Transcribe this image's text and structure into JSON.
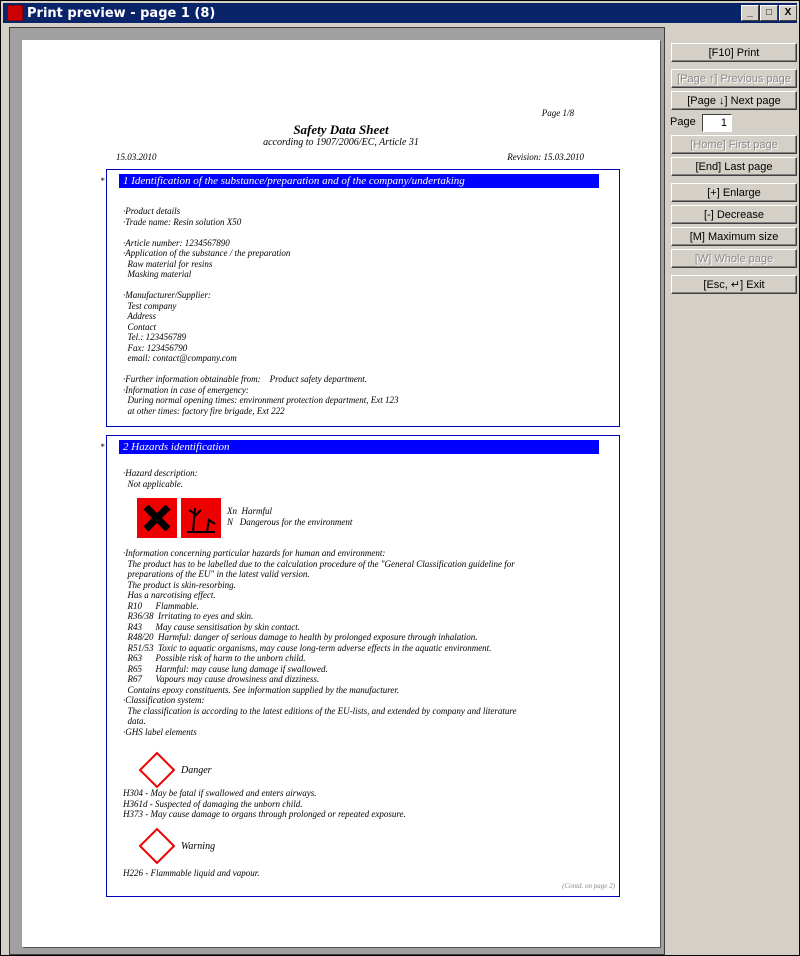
{
  "window": {
    "title": "Print preview - page 1 (8)"
  },
  "controls": {
    "minimize": "_",
    "maximize": "□",
    "close": "X"
  },
  "buttons": [
    {
      "label": "[F10] Print",
      "enabled": true
    },
    {
      "label": "[Page ↑] Previous page",
      "enabled": false
    },
    {
      "label": "[Page ↓] Next page",
      "enabled": true
    },
    {
      "label": "[Home] First page",
      "enabled": false
    },
    {
      "label": "[End] Last page",
      "enabled": true
    },
    {
      "label": "[+] Enlarge",
      "enabled": true
    },
    {
      "label": "[-] Decrease",
      "enabled": true
    },
    {
      "label": "[M] Maximum size",
      "enabled": true
    },
    {
      "label": "[W] Whole page",
      "enabled": false
    },
    {
      "label": "[Esc, ↵] Exit",
      "enabled": true
    }
  ],
  "page_field": {
    "label": "Page",
    "value": "1"
  },
  "document": {
    "page_indicator": "Page 1/8",
    "title": "Safety Data Sheet",
    "subtitle": "according to 1907/2006/EC, Article 31",
    "date_left": "15.03.2010",
    "revision": "Revision: 15.03.2010",
    "section1": {
      "heading": "1 Identification of the substance/preparation and of the company/undertaking",
      "lines": [
        "·Product details",
        "·Trade name: Resin solution X50",
        "",
        "·Article number: 1234567890",
        "·Application of the substance / the preparation",
        "  Raw material for resins",
        "  Masking material",
        "",
        "·Manufacturer/Supplier:",
        "  Test company",
        "  Address",
        "  Contact",
        "  Tel.: 123456789",
        "  Fax: 123456790",
        "  email: contact@company.com",
        "",
        "·Further information obtainable from:    Product safety department.",
        "·Information in case of emergency:",
        "  During normal opening times: environment protection department, Ext 123",
        "  at other times: factory fire brigade, Ext 222"
      ]
    },
    "section2": {
      "heading": "2 Hazards identification",
      "intro": [
        "·Hazard description:",
        "  Not applicable."
      ],
      "symbols_text": [
        "Xn  Harmful",
        "N   Dangerous for the environment"
      ],
      "lines": [
        "·Information concerning particular hazards for human and environment:",
        "  The product has to be labelled due to the calculation procedure of the \"General Classification guideline for",
        "  preparations of the EU\" in the latest valid version.",
        "  The product is skin-resorbing.",
        "  Has a narcotising effect.",
        "  R10      Flammable.",
        "  R36/38  Irritating to eyes and skin.",
        "  R43      May cause sensitisation by skin contact.",
        "  R48/20  Harmful: danger of serious damage to health by prolonged exposure through inhalation.",
        "  R51/53  Toxic to aquatic organisms, may cause long-term adverse effects in the aquatic environment.",
        "  R63      Possible risk of harm to the unborn child.",
        "  R65      Harmful: may cause lung damage if swallowed.",
        "  R67      Vapours may cause drowsiness and dizziness.",
        "  Contains epoxy constituents. See information supplied by the manufacturer.",
        "·Classification system:",
        "  The classification is according to the latest editions of the EU-lists, and extended by company and literature",
        "  data.",
        "·GHS label elements"
      ],
      "ghs1_label": "Danger",
      "h_lines": [
        "H304 - May be fatal if swallowed and enters airways.",
        "H361d - Suspected of damaging the unborn child.",
        "H373 - May cause damage to organs through prolonged or repeated exposure."
      ],
      "ghs2_label": "Warning",
      "h226": "H226 - Flammable liquid and vapour.",
      "contd": "(Contd. on page 2)"
    }
  }
}
